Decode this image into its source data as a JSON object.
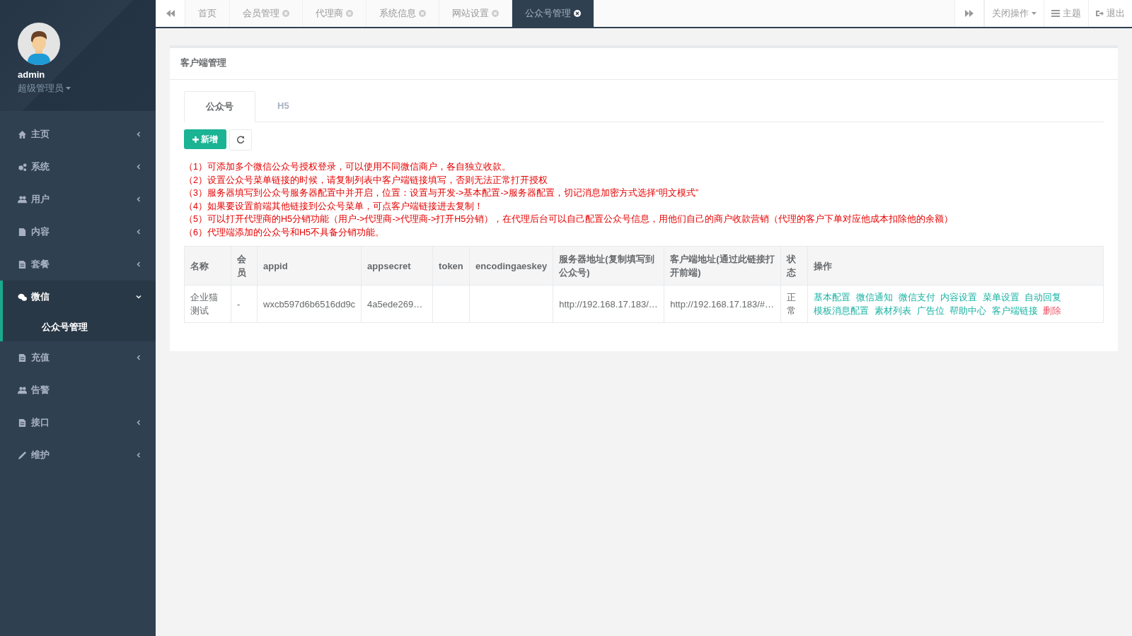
{
  "user": {
    "name": "admin",
    "role": "超级管理员"
  },
  "sidebar": {
    "items": [
      {
        "label": "主页",
        "kind": "group",
        "expanded": false,
        "selected": false
      },
      {
        "label": "系统",
        "kind": "group",
        "expanded": false,
        "selected": false
      },
      {
        "label": "用户",
        "kind": "group",
        "expanded": false,
        "selected": false
      },
      {
        "label": "内容",
        "kind": "group",
        "expanded": false,
        "selected": false
      },
      {
        "label": "套餐",
        "kind": "group",
        "expanded": false,
        "selected": false
      },
      {
        "label": "微信",
        "kind": "group",
        "expanded": true,
        "selected": true,
        "children": [
          {
            "label": "公众号管理",
            "selected": true
          }
        ]
      },
      {
        "label": "充值",
        "kind": "group",
        "expanded": false,
        "selected": false
      },
      {
        "label": "告警",
        "kind": "link",
        "selected": false
      },
      {
        "label": "接口",
        "kind": "group",
        "expanded": false,
        "selected": false
      },
      {
        "label": "维护",
        "kind": "group",
        "expanded": false,
        "selected": false
      }
    ]
  },
  "page_tabs": [
    {
      "label": "首页",
      "closable": false,
      "selected": false
    },
    {
      "label": "会员管理",
      "closable": true,
      "selected": false
    },
    {
      "label": "代理商",
      "closable": true,
      "selected": false
    },
    {
      "label": "系统信息",
      "closable": true,
      "selected": false
    },
    {
      "label": "网站设置",
      "closable": true,
      "selected": false
    },
    {
      "label": "公众号管理",
      "closable": true,
      "selected": true
    }
  ],
  "toolbar": {
    "close_menu": "关闭操作",
    "theme": "主题",
    "logout": "退出"
  },
  "panel": {
    "title": "客户端管理",
    "tabs": [
      {
        "label": "公众号",
        "selected": true
      },
      {
        "label": "H5",
        "selected": false
      }
    ],
    "add_button": "新增",
    "notes": [
      "（1）可添加多个微信公众号授权登录，可以使用不同微信商户，各自独立收款。",
      "（2）设置公众号菜单链接的时候，请复制列表中客户端链接填写，否则无法正常打开授权",
      "（3）服务器填写到公众号服务器配置中并开启，位置：设置与开发->基本配置->服务器配置，切记消息加密方式选择“明文模式”",
      "（4）如果要设置前端其他链接到公众号菜单，可点客户端链接进去复制！",
      "（5）可以打开代理商的H5分销功能（用户->代理商->代理商->打开H5分销），在代理后台可以自己配置公众号信息，用他们自己的商户收款营销（代理的客户下单对应他成本扣除他的余额）",
      "（6）代理端添加的公众号和H5不具备分销功能。"
    ],
    "table": {
      "columns": [
        "名称",
        "会员",
        "appid",
        "appsecret",
        "token",
        "encodingaeskey",
        "服务器地址(复制填写到公众号)",
        "客户端地址(通过此链接打开前端)",
        "状态",
        "操作"
      ],
      "rows": [
        {
          "cells": [
            "企业猫测试",
            "-",
            "wxcb597d6b6516dd9c",
            "4a5ede269…",
            "",
            "",
            "http://192.168.17.183/…",
            "http://192.168.17.183/#…",
            "正常"
          ],
          "actions": [
            {
              "label": "基本配置",
              "kind": "link"
            },
            {
              "label": "微信通知",
              "kind": "link"
            },
            {
              "label": "微信支付",
              "kind": "link"
            },
            {
              "label": "内容设置",
              "kind": "link"
            },
            {
              "label": "菜单设置",
              "kind": "link"
            },
            {
              "label": "自动回复",
              "kind": "link"
            },
            {
              "label": "模板消息配置",
              "kind": "link"
            },
            {
              "label": "素材列表",
              "kind": "link"
            },
            {
              "label": "广告位",
              "kind": "link"
            },
            {
              "label": "帮助中心",
              "kind": "link"
            },
            {
              "label": "客户端链接",
              "kind": "link"
            },
            {
              "label": "删除",
              "kind": "danger"
            }
          ]
        }
      ]
    }
  }
}
